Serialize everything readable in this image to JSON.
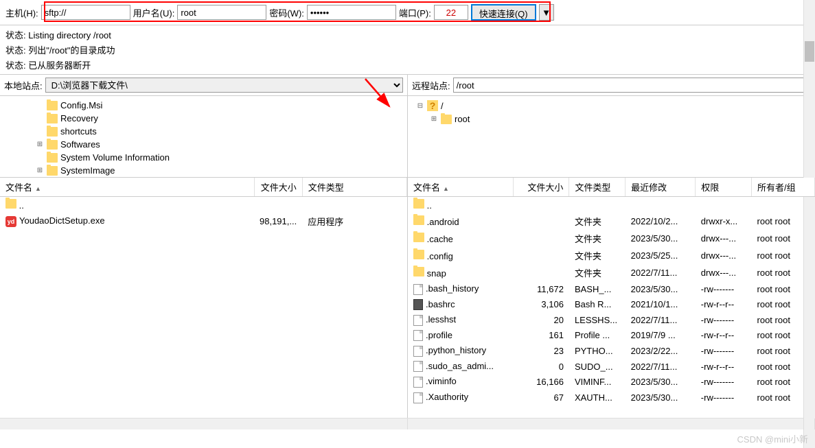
{
  "toolbar": {
    "host_label": "主机(H):",
    "host_value": "sftp://",
    "user_label": "用户名(U):",
    "user_value": "root",
    "pass_label": "密码(W):",
    "pass_value": "••••••",
    "port_label": "端口(P):",
    "port_value": "22",
    "quickconnect_label": "快速连接(Q)",
    "dropdown_glyph": "▼"
  },
  "status": [
    "状态: Listing directory /root",
    "状态: 列出\"/root\"的目录成功",
    "状态: 已从服务器断开"
  ],
  "local": {
    "site_label": "本地站点:",
    "path": "D:\\浏览器下载文件\\",
    "tree": [
      {
        "name": "Config.Msi",
        "indent": 40,
        "exp": ""
      },
      {
        "name": "Recovery",
        "indent": 40,
        "exp": ""
      },
      {
        "name": "shortcuts",
        "indent": 40,
        "exp": ""
      },
      {
        "name": "Softwares",
        "indent": 40,
        "exp": "⊞"
      },
      {
        "name": "System Volume Information",
        "indent": 40,
        "exp": ""
      },
      {
        "name": "SystemImage",
        "indent": 40,
        "exp": "⊞"
      }
    ],
    "columns": [
      "文件名",
      "文件大小",
      "文件类型"
    ],
    "files": [
      {
        "name": "..",
        "size": "",
        "type": "",
        "icon": "folder"
      },
      {
        "name": "YoudaoDictSetup.exe",
        "size": "98,191,...",
        "type": "应用程序",
        "icon": "app",
        "app_text": "yd"
      }
    ]
  },
  "remote": {
    "site_label": "远程站点:",
    "path": "/root",
    "tree": [
      {
        "name": "/",
        "indent": 0,
        "exp": "⊟",
        "icon": "unknown"
      },
      {
        "name": "root",
        "indent": 20,
        "exp": "⊞",
        "icon": "folder"
      }
    ],
    "columns": [
      "文件名",
      "文件大小",
      "文件类型",
      "最近修改",
      "权限",
      "所有者/组"
    ],
    "files": [
      {
        "name": "..",
        "size": "",
        "type": "",
        "mod": "",
        "perm": "",
        "own": "",
        "icon": "folder"
      },
      {
        "name": ".android",
        "size": "",
        "type": "文件夹",
        "mod": "2022/10/2...",
        "perm": "drwxr-x...",
        "own": "root root",
        "icon": "folder"
      },
      {
        "name": ".cache",
        "size": "",
        "type": "文件夹",
        "mod": "2023/5/30...",
        "perm": "drwx---...",
        "own": "root root",
        "icon": "folder"
      },
      {
        "name": ".config",
        "size": "",
        "type": "文件夹",
        "mod": "2023/5/25...",
        "perm": "drwx---...",
        "own": "root root",
        "icon": "folder"
      },
      {
        "name": "snap",
        "size": "",
        "type": "文件夹",
        "mod": "2022/7/11...",
        "perm": "drwx---...",
        "own": "root root",
        "icon": "folder"
      },
      {
        "name": ".bash_history",
        "size": "11,672",
        "type": "BASH_...",
        "mod": "2023/5/30...",
        "perm": "-rw-------",
        "own": "root root",
        "icon": "file"
      },
      {
        "name": ".bashrc",
        "size": "3,106",
        "type": "Bash R...",
        "mod": "2021/10/1...",
        "perm": "-rw-r--r--",
        "own": "root root",
        "icon": "bashrc"
      },
      {
        "name": ".lesshst",
        "size": "20",
        "type": "LESSHS...",
        "mod": "2022/7/11...",
        "perm": "-rw-------",
        "own": "root root",
        "icon": "file"
      },
      {
        "name": ".profile",
        "size": "161",
        "type": "Profile ...",
        "mod": "2019/7/9 ...",
        "perm": "-rw-r--r--",
        "own": "root root",
        "icon": "file"
      },
      {
        "name": ".python_history",
        "size": "23",
        "type": "PYTHO...",
        "mod": "2023/2/22...",
        "perm": "-rw-------",
        "own": "root root",
        "icon": "file"
      },
      {
        "name": ".sudo_as_admi...",
        "size": "0",
        "type": "SUDO_...",
        "mod": "2022/7/11...",
        "perm": "-rw-r--r--",
        "own": "root root",
        "icon": "file"
      },
      {
        "name": ".viminfo",
        "size": "16,166",
        "type": "VIMINF...",
        "mod": "2023/5/30...",
        "perm": "-rw-------",
        "own": "root root",
        "icon": "file"
      },
      {
        "name": ".Xauthority",
        "size": "67",
        "type": "XAUTH...",
        "mod": "2023/5/30...",
        "perm": "-rw-------",
        "own": "root root",
        "icon": "file"
      }
    ]
  },
  "watermark": "CSDN @mini小新"
}
